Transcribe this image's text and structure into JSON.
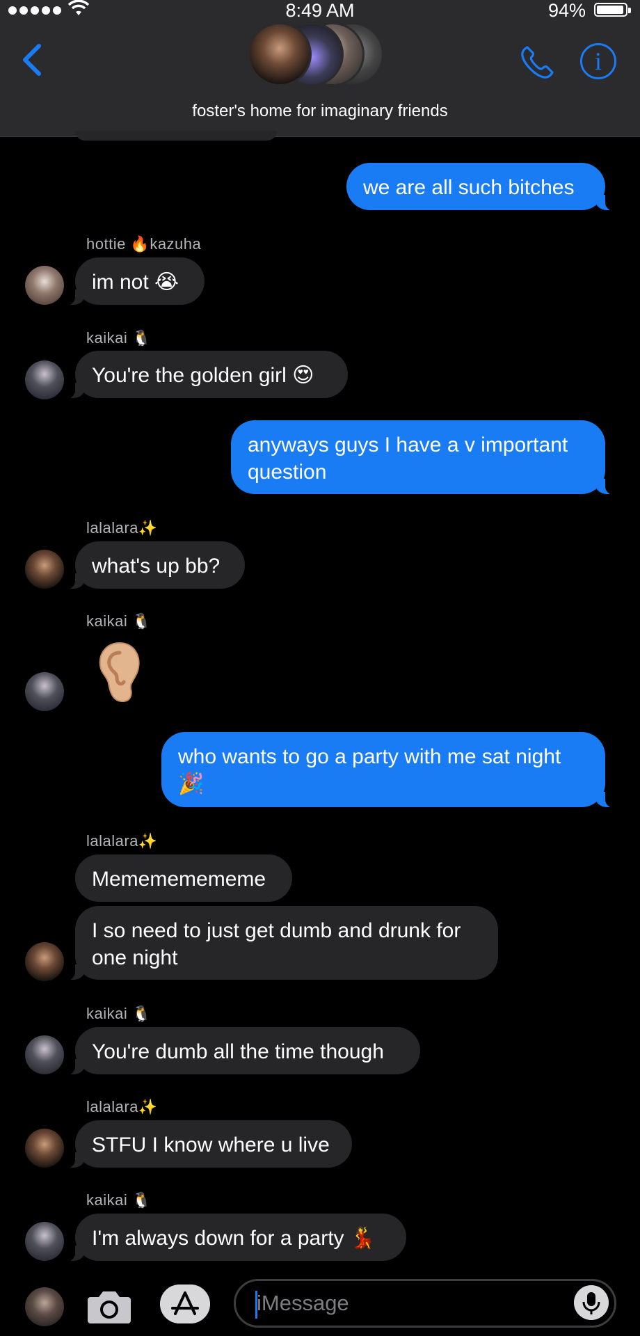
{
  "status_bar": {
    "time": "8:49 AM",
    "battery_percent": "94%",
    "battery_level": 0.94,
    "signal_bars": 5
  },
  "header": {
    "group_name": "foster's home for imaginary friends",
    "back_icon": "chevron-left-icon",
    "call_icon": "phone-icon",
    "info_icon": "info-icon",
    "info_glyph": "i"
  },
  "colors": {
    "accent": "#1a7cf5",
    "incoming_bubble": "#262628",
    "background": "#000000"
  },
  "messages": [
    {
      "direction": "outgoing",
      "text": "we are all such bitches"
    },
    {
      "direction": "incoming",
      "sender": "hottie 🔥kazuha",
      "text": "im not 😭"
    },
    {
      "direction": "incoming",
      "sender": "kaikai 🐧",
      "text": "You're the golden girl 😍"
    },
    {
      "direction": "outgoing",
      "text": "anyways guys I have a v important question"
    },
    {
      "direction": "incoming",
      "sender": "lalalara✨",
      "text": "what's up bb?"
    },
    {
      "direction": "incoming",
      "sender": "kaikai 🐧",
      "text": "👂",
      "emoji_only": true
    },
    {
      "direction": "outgoing",
      "text": "who wants to go a party with me sat night 🎉"
    },
    {
      "direction": "incoming",
      "sender": "lalalara✨",
      "text": "Memememememe"
    },
    {
      "direction": "incoming",
      "text": "I so need to just get dumb and drunk for one night"
    },
    {
      "direction": "incoming",
      "sender": "kaikai 🐧",
      "text": "You're dumb all the time though"
    },
    {
      "direction": "incoming",
      "sender": "lalalara✨",
      "text": "STFU I know where u live"
    },
    {
      "direction": "incoming",
      "sender": "kaikai 🐧",
      "text": "I'm always down for a party 💃"
    }
  ],
  "composer": {
    "placeholder": "iMessage",
    "camera_icon": "camera-icon",
    "apps_icon": "app-store-icon",
    "mic_icon": "microphone-icon"
  }
}
